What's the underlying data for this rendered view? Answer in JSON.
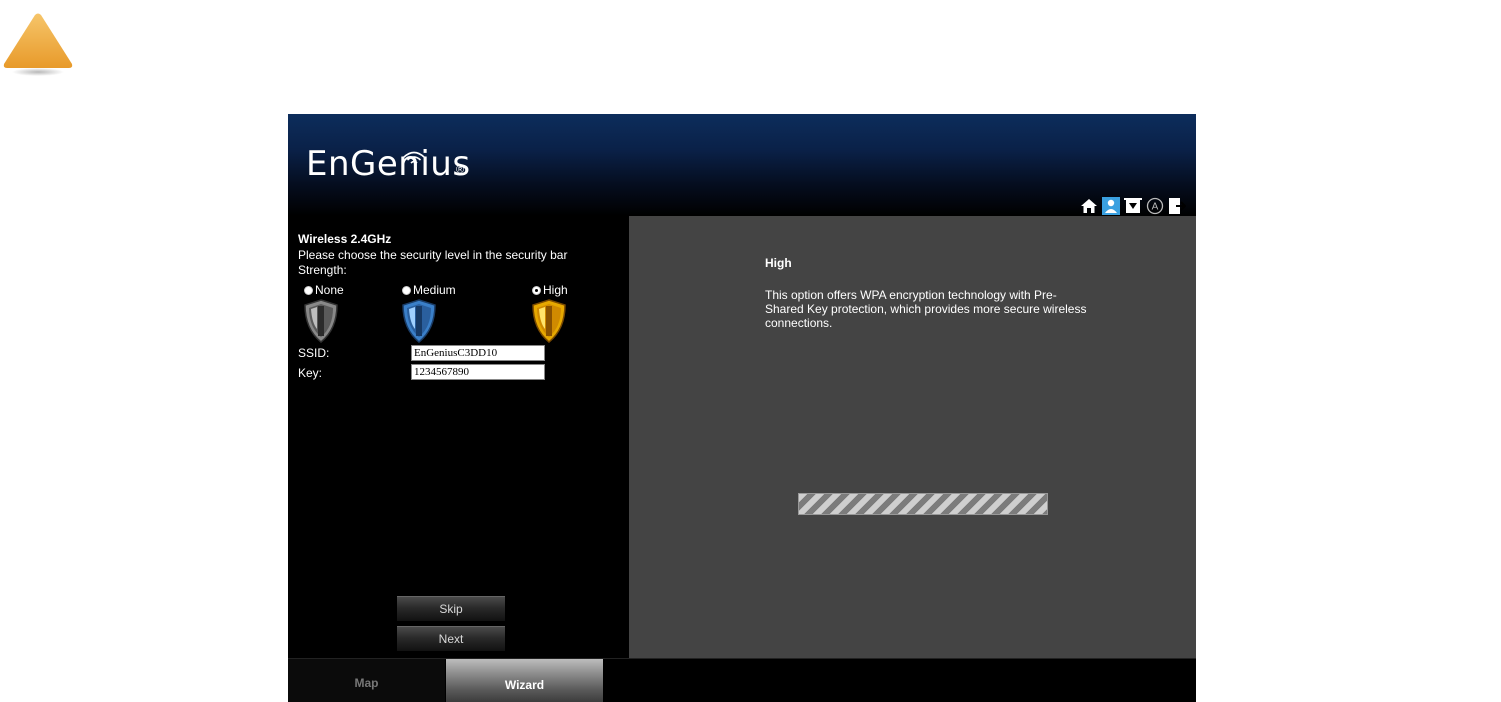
{
  "warning_icon": "warning-triangle-icon",
  "header": {
    "logo_text": "EnGenius",
    "logo_mark": "®",
    "icons": [
      "home-icon",
      "user-icon",
      "network-icon",
      "a-circle-icon",
      "logout-icon"
    ]
  },
  "wizard": {
    "title": "Wireless 2.4GHz",
    "instruction": "Please choose the security level in the security bar",
    "strength_label": "Strength:",
    "options": [
      {
        "label": "None",
        "checked": false,
        "color": "#7a7a7a"
      },
      {
        "label": "Medium",
        "checked": false,
        "color": "#3a7fc8"
      },
      {
        "label": "High",
        "checked": true,
        "color": "#e6a800"
      }
    ],
    "ssid_label": "SSID:",
    "ssid_value": "EnGeniusC3DD10",
    "key_label": "Key:",
    "key_value": "1234567890",
    "skip_label": "Skip",
    "next_label": "Next"
  },
  "detail": {
    "title": "High",
    "description": "This option offers WPA encryption technology with Pre-Shared Key protection, which provides more secure wireless connections.",
    "progress": 1.0
  },
  "tabs": {
    "map": "Map",
    "wizard": "Wizard",
    "active": "Wizard"
  },
  "colors": {
    "accent_warning": "#f0a830",
    "panel_right": "#444444",
    "header_blue": "#0d2d5c"
  }
}
